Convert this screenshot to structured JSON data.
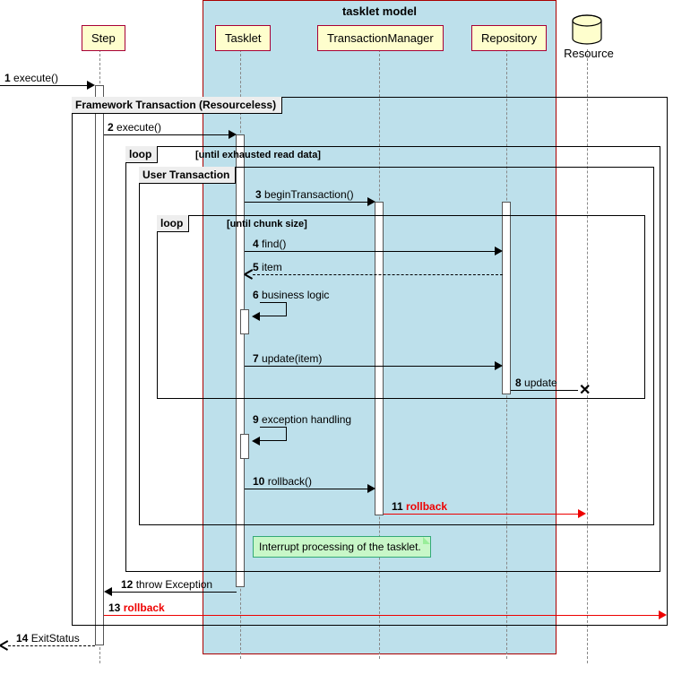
{
  "title": "tasklet model",
  "participants": {
    "step": "Step",
    "tasklet": "Tasklet",
    "txmanager": "TransactionManager",
    "repository": "Repository",
    "resource": "Resource"
  },
  "frames": {
    "fw_tx": "Framework Transaction (Resourceless)",
    "loop1": "loop",
    "loop1_cond": "[until exhausted read data]",
    "user_tx": "User Transaction",
    "loop2": "loop",
    "loop2_cond": "[until chunk size]"
  },
  "messages": {
    "m1": {
      "n": "1",
      "t": "execute()"
    },
    "m2": {
      "n": "2",
      "t": "execute()"
    },
    "m3": {
      "n": "3",
      "t": "beginTransaction()"
    },
    "m4": {
      "n": "4",
      "t": "find()"
    },
    "m5": {
      "n": "5",
      "t": "item"
    },
    "m6": {
      "n": "6",
      "t": "business logic"
    },
    "m7": {
      "n": "7",
      "t": "update(item)"
    },
    "m8": {
      "n": "8",
      "t": "update"
    },
    "m9": {
      "n": "9",
      "t": "exception handling"
    },
    "m10": {
      "n": "10",
      "t": "rollback()"
    },
    "m11": {
      "n": "11",
      "t": "rollback"
    },
    "m12": {
      "n": "12",
      "t": "throw Exception"
    },
    "m13": {
      "n": "13",
      "t": "rollback"
    },
    "m14": {
      "n": "14",
      "t": "ExitStatus"
    }
  },
  "note": "Interrupt processing of the tasklet."
}
